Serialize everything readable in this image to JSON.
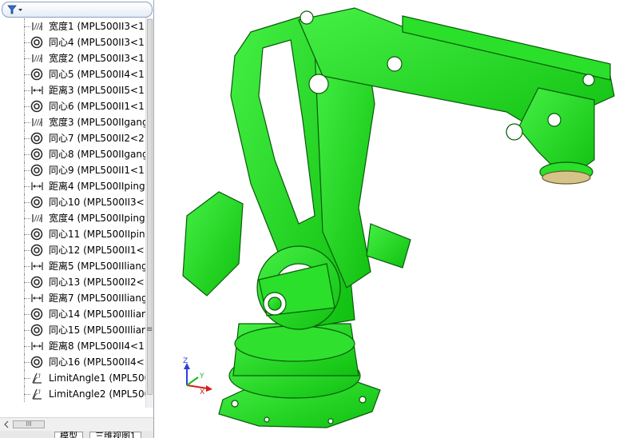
{
  "feature_tree": {
    "items": [
      {
        "type": "width",
        "icon": "width-mate-icon",
        "label": "宽度1 (MPL500II3<1"
      },
      {
        "type": "concentric",
        "icon": "concentric-mate-icon",
        "label": "同心4 (MPL500II3<1"
      },
      {
        "type": "width",
        "icon": "width-mate-icon",
        "label": "宽度2 (MPL500II3<1"
      },
      {
        "type": "concentric",
        "icon": "concentric-mate-icon",
        "label": "同心5 (MPL500II4<1"
      },
      {
        "type": "distance",
        "icon": "distance-mate-icon",
        "label": "距离3 (MPL500II5<1"
      },
      {
        "type": "concentric",
        "icon": "concentric-mate-icon",
        "label": "同心6 (MPL500II1<1"
      },
      {
        "type": "width",
        "icon": "width-mate-icon",
        "label": "宽度3 (MPL500IIgang"
      },
      {
        "type": "concentric",
        "icon": "concentric-mate-icon",
        "label": "同心7 (MPL500II2<2"
      },
      {
        "type": "concentric",
        "icon": "concentric-mate-icon",
        "label": "同心8 (MPL500IIgang"
      },
      {
        "type": "concentric",
        "icon": "concentric-mate-icon",
        "label": "同心9 (MPL500II1<1"
      },
      {
        "type": "distance",
        "icon": "distance-mate-icon",
        "label": "距离4 (MPL500IIping"
      },
      {
        "type": "concentric",
        "icon": "concentric-mate-icon",
        "label": "同心10 (MPL500II3<"
      },
      {
        "type": "width",
        "icon": "width-mate-icon",
        "label": "宽度4 (MPL500IIping"
      },
      {
        "type": "concentric",
        "icon": "concentric-mate-icon",
        "label": "同心11 (MPL500IIpin"
      },
      {
        "type": "concentric",
        "icon": "concentric-mate-icon",
        "label": "同心12 (MPL500II1<"
      },
      {
        "type": "distance",
        "icon": "distance-mate-icon",
        "label": "距离5 (MPL500IIliang"
      },
      {
        "type": "concentric",
        "icon": "concentric-mate-icon",
        "label": "同心13 (MPL500II2<"
      },
      {
        "type": "distance",
        "icon": "distance-mate-icon",
        "label": "距离7 (MPL500IIliang"
      },
      {
        "type": "concentric",
        "icon": "concentric-mate-icon",
        "label": "同心14 (MPL500IIliar"
      },
      {
        "type": "concentric",
        "icon": "concentric-mate-icon",
        "label": "同心15 (MPL500IIliar"
      },
      {
        "type": "distance",
        "icon": "distance-mate-icon",
        "label": "距离8 (MPL500II4<1"
      },
      {
        "type": "concentric",
        "icon": "concentric-mate-icon",
        "label": "同心16 (MPL500II4<"
      },
      {
        "type": "angle",
        "icon": "limit-angle-icon",
        "label": "LimitAngle1 (MPL500"
      },
      {
        "type": "angle",
        "icon": "limit-angle-icon",
        "label": "LimitAngle2 (MPL500"
      }
    ]
  },
  "scrollbar": {
    "thumb_grip": "III",
    "side_grip": "≡"
  },
  "bottom_tabs": [
    "模型",
    "三维视图1"
  ],
  "triad": {
    "x_label": "X",
    "y_label": "Y",
    "z_label": "Z"
  },
  "colors": {
    "model_green": "#1fdc1f",
    "model_edge": "#0a6a0a",
    "x_axis": "#d81b1b",
    "y_axis": "#1bb81b",
    "z_axis": "#2a3fd8",
    "panel_border": "#9aa6b4"
  }
}
